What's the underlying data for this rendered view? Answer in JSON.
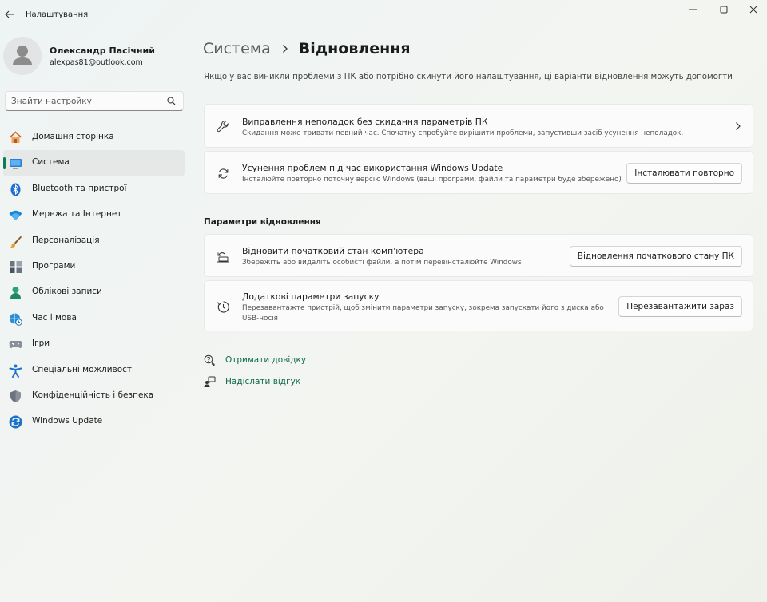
{
  "window": {
    "title": "Налаштування"
  },
  "user": {
    "name": "Олександр Пасічний",
    "email": "alexpas81@outlook.com"
  },
  "search": {
    "placeholder": "Знайти настройку"
  },
  "sidebar": {
    "items": [
      {
        "label": "Домашня сторінка",
        "icon": "home-icon"
      },
      {
        "label": "Система",
        "icon": "monitor-icon",
        "active": true
      },
      {
        "label": "Bluetooth та пристрої",
        "icon": "bluetooth-icon"
      },
      {
        "label": "Мережа та Інтернет",
        "icon": "wifi-icon"
      },
      {
        "label": "Персоналізація",
        "icon": "brush-icon"
      },
      {
        "label": "Програми",
        "icon": "apps-icon"
      },
      {
        "label": "Облікові записи",
        "icon": "person-icon"
      },
      {
        "label": "Час і мова",
        "icon": "globe-clock-icon"
      },
      {
        "label": "Ігри",
        "icon": "gamepad-icon"
      },
      {
        "label": "Спеціальні можливості",
        "icon": "accessibility-icon"
      },
      {
        "label": "Конфіденційність і безпека",
        "icon": "shield-icon"
      },
      {
        "label": "Windows Update",
        "icon": "update-icon"
      }
    ]
  },
  "main": {
    "breadcrumb_parent": "Система",
    "breadcrumb_current": "Відновлення",
    "intro": "Якщо у вас виникли проблеми з ПК або потрібно скинути його налаштування, ці варіанти відновлення можуть допомогти",
    "fix_card": {
      "title": "Виправлення неполадок без скидання параметрів ПК",
      "desc": "Скидання може тривати певний час. Спочатку спробуйте вирішити проблеми, запустивши засіб усунення неполадок."
    },
    "update_card": {
      "title": "Усунення проблем під час використання Windows Update",
      "desc": "Інсталюйте повторно поточну версію Windows (ваші програми, файли та параметри буде збережено)",
      "button": "Інсталювати повторно"
    },
    "section_title": "Параметри відновлення",
    "reset_card": {
      "title": "Відновити початковий стан комп'ютера",
      "desc": "Збережіть або видаліть особисті файли, а потім перевінсталюйте Windows",
      "button": "Відновлення початкового стану ПК"
    },
    "startup_card": {
      "title": "Додаткові параметри запуску",
      "desc": "Перезавантажте пристрій, щоб змінити параметри запуску, зокрема запускати його з диска або USB-носія",
      "button": "Перезавантажити зараз"
    },
    "links": {
      "help": "Отримати довідку",
      "feedback": "Надіслати відгук"
    }
  },
  "colors": {
    "accent": "#0f7b54",
    "link": "#0f6b47"
  }
}
